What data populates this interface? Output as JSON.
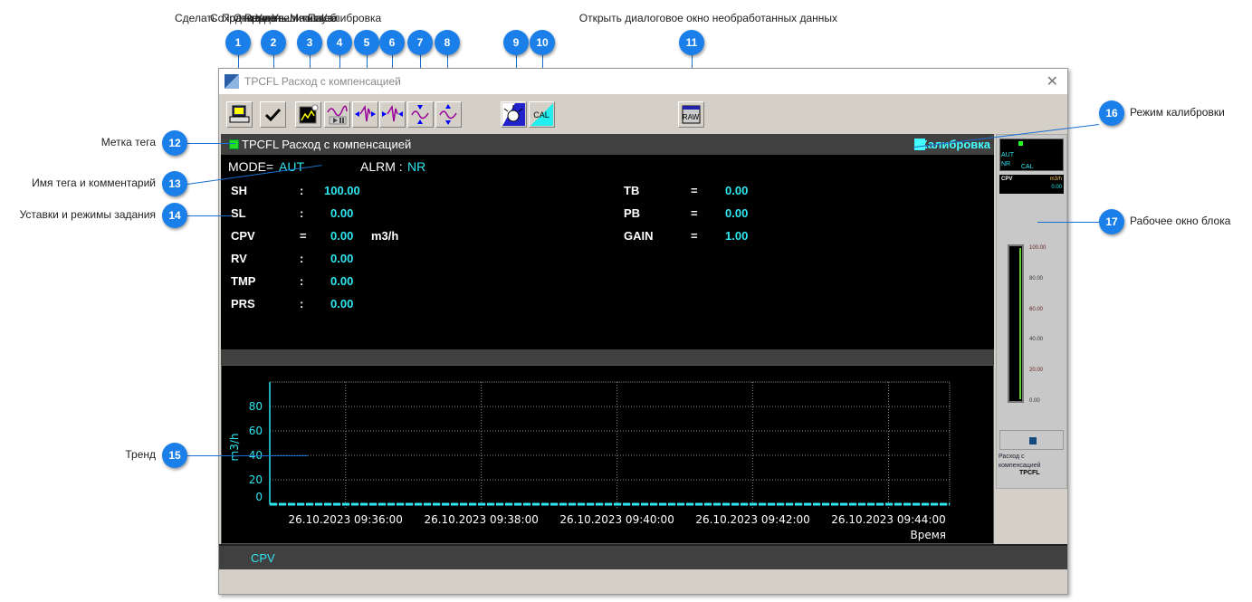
{
  "callouts": {
    "top_overlapped": [
      "Сделать",
      "Сохранить",
      "Подтвердить",
      "Открыть",
      "Режим",
      "Уменьшить",
      "Увеличить",
      "Масштаб",
      "Пауза",
      "Калибровка",
      "Открыть диалоговое окно необработанных данных"
    ],
    "badges_top": [
      "1",
      "2",
      "3",
      "4",
      "5",
      "6",
      "7",
      "8",
      "9",
      "10",
      "11"
    ],
    "left": [
      {
        "n": "12",
        "label": "Метка тега"
      },
      {
        "n": "13",
        "label": "Имя тега и комментарий"
      },
      {
        "n": "14",
        "label": "Уставки и режимы задания"
      },
      {
        "n": "15",
        "label": "Тренд"
      }
    ],
    "right": [
      {
        "n": "16",
        "label": "Режим калибровки"
      },
      {
        "n": "17",
        "label": "Рабочее окно блока"
      }
    ]
  },
  "window": {
    "title": "TPCFL Расход с компенсацией",
    "close_icon": "close-icon"
  },
  "toolbar": {
    "buttons": [
      "print-screen-icon",
      "confirm-check-icon",
      "trend-snapshot-icon",
      "trend-pause-icon",
      "zoom-in-horizontal-icon",
      "zoom-out-horizontal-icon",
      "zoom-in-vertical-icon",
      "zoom-out-vertical-icon",
      "alarm-light-icon",
      "cal-icon",
      "raw-data-icon"
    ],
    "cal_label": "CAL",
    "raw_label": "RAW"
  },
  "header": {
    "tag": "TPCFL Расход с компенсацией",
    "tag_color": "#22dd22",
    "calibration": "Калибровка",
    "calibration_color": "#44ffff"
  },
  "status": {
    "mode_label": "MODE=",
    "mode": "AUT",
    "alrm_label": "ALRM :",
    "alrm": "NR"
  },
  "params_left": [
    {
      "name": "SH",
      "sep": ":",
      "value": "100.00",
      "unit": ""
    },
    {
      "name": "SL",
      "sep": ":",
      "value": "0.00",
      "unit": ""
    },
    {
      "name": "CPV",
      "sep": "=",
      "value": "0.00",
      "unit": "m3/h"
    },
    {
      "name": "RV",
      "sep": ":",
      "value": "0.00",
      "unit": ""
    },
    {
      "name": "TMP",
      "sep": ":",
      "value": "0.00",
      "unit": ""
    },
    {
      "name": "PRS",
      "sep": ":",
      "value": "0.00",
      "unit": ""
    }
  ],
  "params_right": [
    {
      "name": "TB",
      "sep": "=",
      "value": "0.00"
    },
    {
      "name": "PB",
      "sep": "=",
      "value": "0.00"
    },
    {
      "name": "GAIN",
      "sep": "=",
      "value": "1.00"
    }
  ],
  "legend": {
    "series": "CPV"
  },
  "chart_data": {
    "type": "line",
    "ylabel": "m3/h",
    "xlabel": "Время",
    "ylim": [
      0,
      100
    ],
    "yticks": [
      "80",
      "60",
      "40",
      "20",
      "0"
    ],
    "xticks": [
      "26.10.2023 09:36:00",
      "26.10.2023 09:38:00",
      "26.10.2023 09:40:00",
      "26.10.2023 09:42:00",
      "26.10.2023 09:44:00"
    ],
    "xlim": [
      "26.10.2023 09:34:53",
      "26.10.2023 09:44:54"
    ],
    "grid": true,
    "series": [
      {
        "name": "CPV",
        "color": "#2ee8f0",
        "values": [
          0,
          0,
          0,
          0,
          0,
          0,
          0,
          0,
          0,
          0,
          0
        ]
      }
    ]
  },
  "faceplate": {
    "mode": "AUT",
    "alarm": "NR",
    "cal": "CAL",
    "pv_name": "CPV",
    "unit": "m3/h",
    "value": "0.00",
    "scale": [
      "100.00",
      "80.00",
      "60.00",
      "40.00",
      "20.00",
      "0.00"
    ],
    "bar_fill_percent": 0,
    "comment": "Расход с компенсацией",
    "tag": "TPCFL"
  }
}
